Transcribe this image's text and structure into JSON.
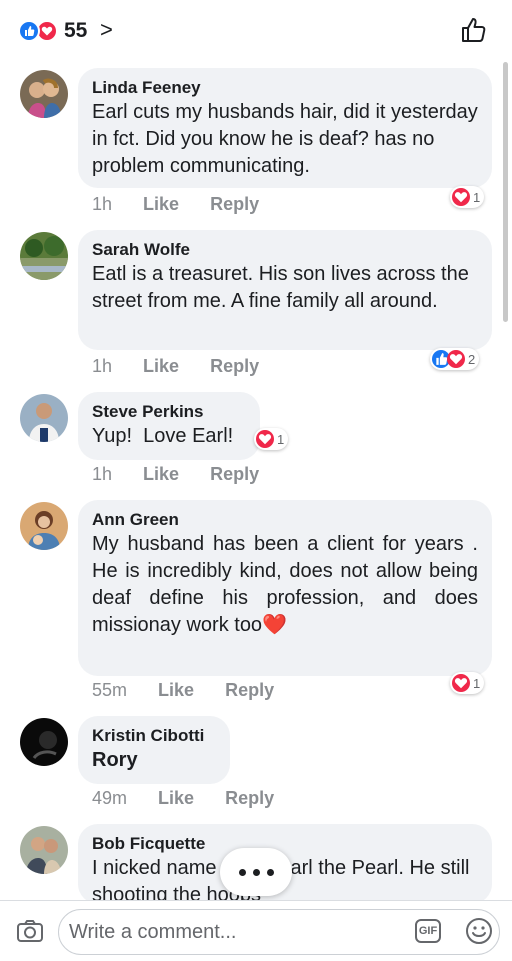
{
  "header": {
    "reaction_count": "55",
    "chevron": ">",
    "reactions": [
      "like-icon",
      "love-icon"
    ],
    "like_icon": "thumbs-up-outline-icon"
  },
  "comments": [
    {
      "author": "Linda Feeney",
      "text": "Earl cuts my husbands hair, did it yesterday in fct. Did you know he is deaf? has no problem communicating.",
      "time": "1h",
      "like": "Like",
      "reply": "Reply",
      "reaction_count": "1"
    },
    {
      "author": "Sarah Wolfe",
      "text": "Eatl is a treasuret. His son lives across the street from me. A fine family all around.",
      "time": "1h",
      "like": "Like",
      "reply": "Reply",
      "reaction_count": "2"
    },
    {
      "author": "Steve Perkins",
      "text": "Yup!  Love Earl!",
      "time": "1h",
      "like": "Like",
      "reply": "Reply",
      "reaction_count": "1"
    },
    {
      "author": "Ann Green",
      "text": "My husband has been a client for years . He is incredibly kind, does not allow being deaf define his profession, and does missionay work too",
      "emoji": "❤️",
      "time": "55m",
      "like": "Like",
      "reply": "Reply",
      "reaction_count": "1"
    },
    {
      "author": "Kristin Cibotti",
      "text": "Rory",
      "time": "49m",
      "like": "Like",
      "reply": "Reply"
    },
    {
      "author": "Bob Ficquette",
      "text_visible_1": "I nicked name",
      "text_visible_2": "arl the Pearl. He still",
      "text_visible_3": "shooting the hoops"
    }
  ],
  "composer": {
    "placeholder": "Write a comment...",
    "gif_label": "GIF"
  },
  "colors": {
    "like_blue": "#1877f2",
    "love_red": "#f0284a",
    "bubble": "#f0f2f5",
    "meta_gray": "#8a8d91"
  }
}
